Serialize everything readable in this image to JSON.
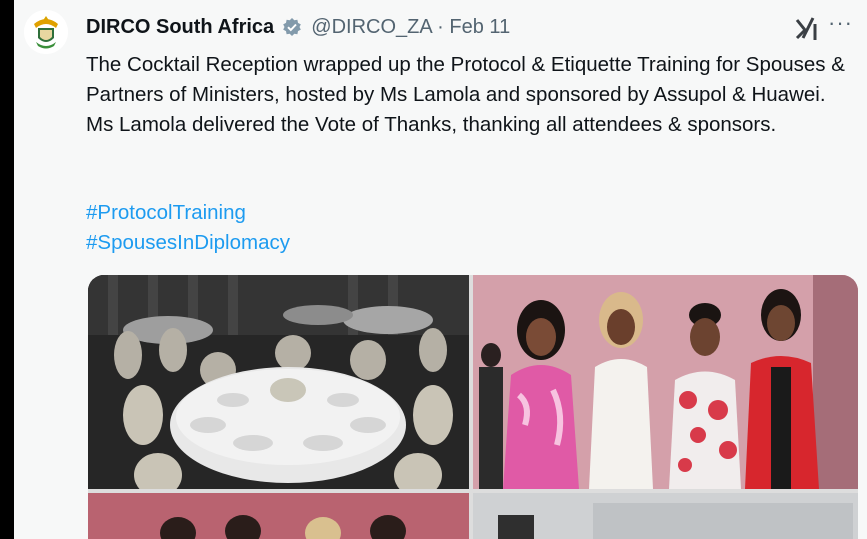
{
  "tweet": {
    "author_name": "DIRCO South Africa",
    "handle": "@DIRCO_ZA",
    "separator": "·",
    "date": "Feb 11",
    "text": "The Cocktail Reception wrapped up the Protocol & Etiquette Training for Spouses & Partners of Ministers, hosted by Ms Lamola and sponsored by Assupol & Huawei. Ms Lamola delivered the Vote of Thanks, thanking all attendees & sponsors.",
    "hashtags": [
      "#ProtocolTraining",
      "#SpousesInDiplomacy"
    ],
    "more_label": "···",
    "icons": {
      "avatar": "south-africa-coat-of-arms",
      "verified": "verified-badge-icon",
      "grok": "grok-icon",
      "more": "more-icon"
    },
    "media": [
      {
        "name": "banquet-table-photo"
      },
      {
        "name": "four-women-photo"
      },
      {
        "name": "group-photo"
      },
      {
        "name": "event-room-photo"
      }
    ]
  },
  "colors": {
    "link": "#1d9bf0",
    "text": "#0f1419",
    "muted": "#536471",
    "background": "#f7f8f8"
  }
}
